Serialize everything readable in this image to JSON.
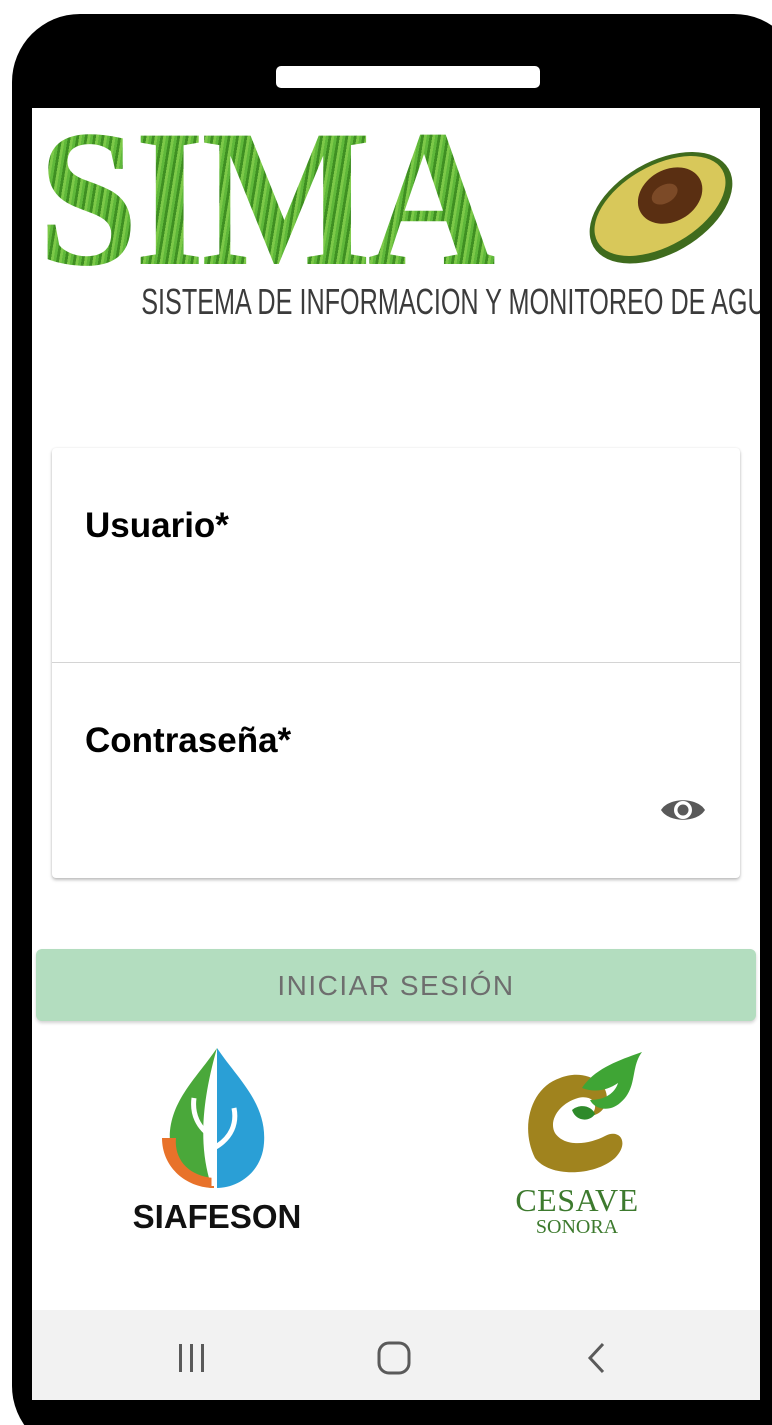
{
  "app": {
    "logo_text": "SIMA",
    "logo_subtitle": "SISTEMA DE INFORMACION Y MONITOREO DE AGUACATE"
  },
  "form": {
    "username_label": "Usuario*",
    "username_value": "",
    "password_label": "Contraseña*",
    "password_value": "",
    "password_toggle_icon": "eye-icon"
  },
  "actions": {
    "login_label": "INICIAR SESIÓN"
  },
  "partners": {
    "siafeson_name": "SIAFESON",
    "cesave_name": "CESAVE",
    "cesave_region": "SONORA"
  },
  "navbar": {
    "recents_icon": "recents-icon",
    "home_icon": "home-icon",
    "back_icon": "back-icon"
  },
  "colors": {
    "brand_green": "#5fb83a",
    "login_button_bg": "#b3ddbf",
    "login_button_text": "#6e6e6e",
    "navbar_bg": "#f2f2f2",
    "cesave_green": "#3d7a2e"
  }
}
